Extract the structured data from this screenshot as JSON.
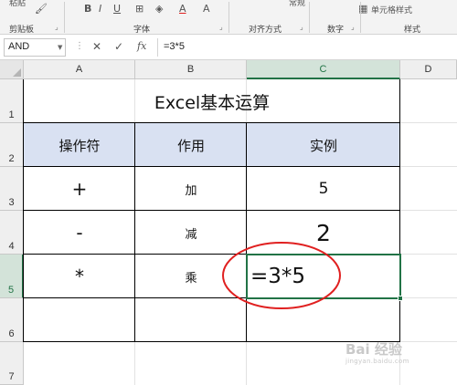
{
  "ribbon": {
    "top_texts": [
      "粘贴",
      "常规"
    ],
    "font_buttons": [
      "B",
      "I",
      "U",
      "A",
      "A"
    ],
    "groups": [
      "剪贴板",
      "字体",
      "对齐方式",
      "数字",
      "样式"
    ],
    "style_button": "单元格样式"
  },
  "formula_bar": {
    "name_box": "AND",
    "cancel_label": "✕",
    "enter_label": "✓",
    "fx_label": "fx",
    "formula": "=3*5"
  },
  "sheet": {
    "columns": [
      "A",
      "B",
      "C",
      "D"
    ],
    "rows": [
      "1",
      "2",
      "3",
      "4",
      "5",
      "6",
      "7"
    ],
    "selected_column": "C",
    "selected_row": "5",
    "title": "Excel基本运算",
    "headers": [
      "操作符",
      "作用",
      "实例"
    ],
    "body": [
      {
        "op": "+",
        "role": "加",
        "example": "5"
      },
      {
        "op": "-",
        "role": "减",
        "example": "2"
      },
      {
        "op": "*",
        "role": "乘",
        "example": "=3*5"
      }
    ]
  },
  "watermark": {
    "brand": "Bai 经验",
    "url": "jingyan.baidu.com"
  },
  "colors": {
    "header_fill": "#d9e1f2",
    "selection": "#217346",
    "annotation": "#e02020"
  }
}
